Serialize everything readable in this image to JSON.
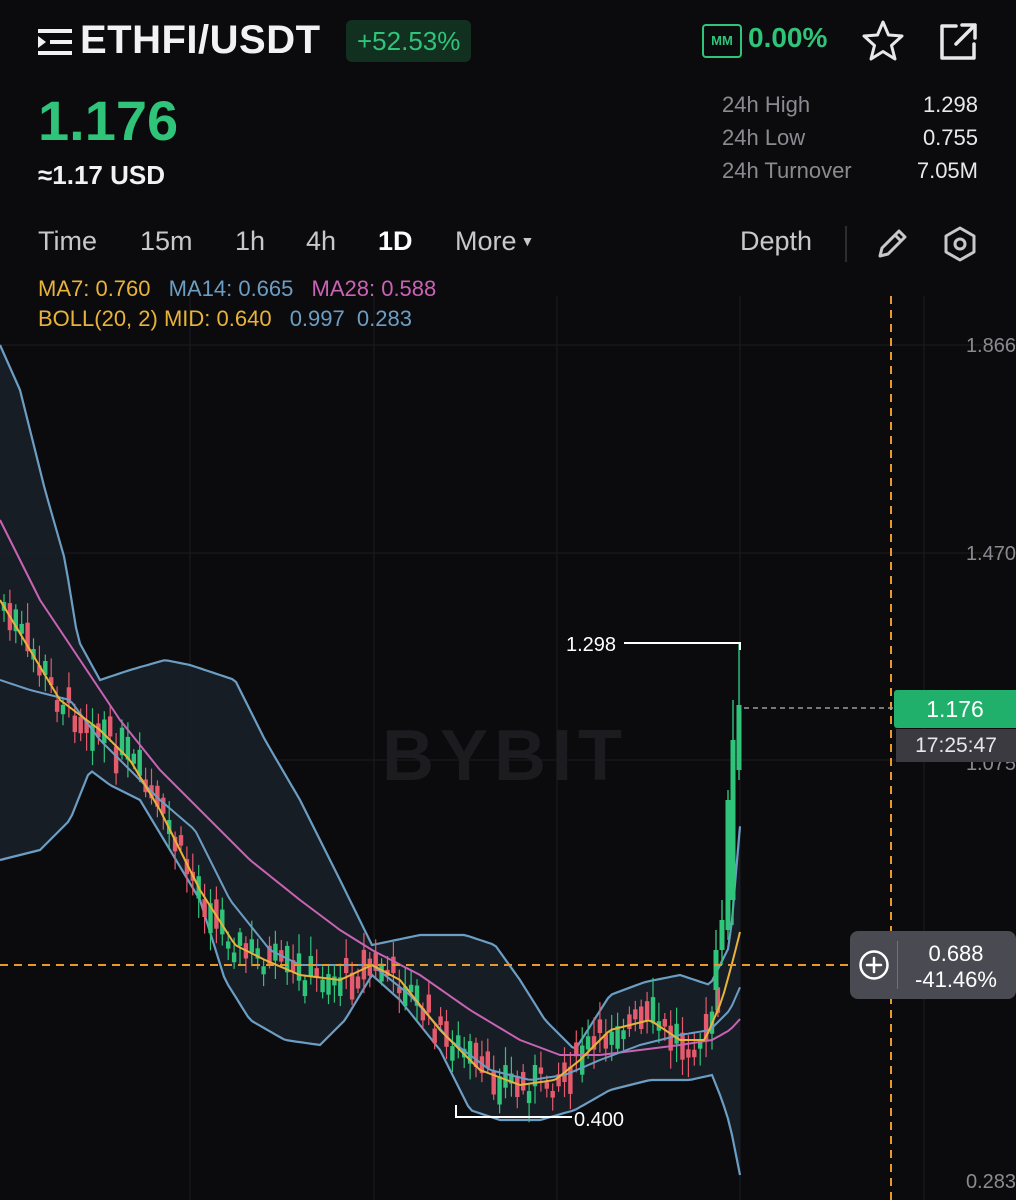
{
  "header": {
    "pair": "ETHFI/USDT",
    "change": "+52.53%",
    "mm_label": "MM",
    "mm_value": "0.00%"
  },
  "price": {
    "last": "1.176",
    "usd": "≈1.17 USD"
  },
  "stats": [
    {
      "label": "24h High",
      "value": "1.298"
    },
    {
      "label": "24h Low",
      "value": "0.755"
    },
    {
      "label": "24h Turnover",
      "value": "7.05M"
    }
  ],
  "tabs": [
    {
      "label": "Time",
      "active": false
    },
    {
      "label": "15m",
      "active": false
    },
    {
      "label": "1h",
      "active": false
    },
    {
      "label": "4h",
      "active": false
    },
    {
      "label": "1D",
      "active": true
    },
    {
      "label": "More",
      "active": false
    }
  ],
  "depth_label": "Depth",
  "indicators": {
    "ma7": "MA7: 0.760",
    "ma14": "MA14: 0.665",
    "ma28": "MA28: 0.588",
    "boll": "BOLL(20, 2) MID: 0.640",
    "boll_upper": "0.997",
    "boll_lower": "0.283"
  },
  "colors": {
    "up": "#2fc47a",
    "down": "#e55a6c",
    "ma7": "#e8b33a",
    "ma14": "#6c9ec4",
    "ma28": "#c963b4",
    "crosshair": "#e69a2e"
  },
  "chart_data": {
    "type": "candlestick",
    "y_axis_labels": [
      "1.866",
      "1.470",
      "1.075",
      "0.283"
    ],
    "ylim": [
      0.283,
      1.866
    ],
    "high_marker": "1.298",
    "low_marker": "0.400",
    "watermark": "BYBIT",
    "last_price_tag": "1.176",
    "countdown": "17:25:47",
    "crosshair_price": "0.688",
    "crosshair_change": "-41.46%"
  }
}
